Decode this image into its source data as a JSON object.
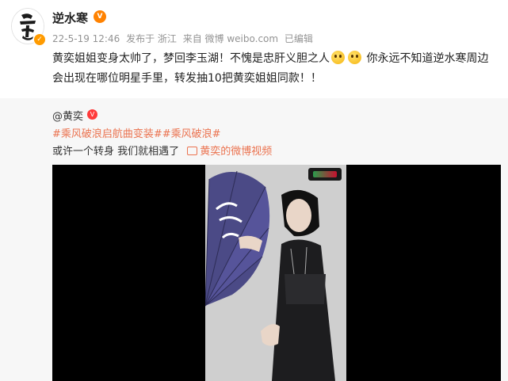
{
  "post": {
    "author": "逆水寒",
    "date": "22-5-19 12:46",
    "published_from": "发布于 浙江",
    "source": "来自 微博 weibo.com",
    "edited": "已编辑",
    "text_part1": "黄奕姐姐变身太帅了，梦回李玉湖！不愧是忠肝义胆之人",
    "text_part2": "你永远不知道逆水寒周边会出现在哪位明星手里，转发抽10把黄奕姐姐同款！！",
    "icons": [
      "avatar-logo",
      "verified-badge",
      "vip-icon",
      "emoji-face"
    ]
  },
  "repost": {
    "author": "@黄奕",
    "hashtags": "#乘风破浪启航曲变装##乘风破浪#",
    "text": "或许一个转身 我们就相遇了",
    "video_link": "黄奕的微博视频"
  },
  "colors": {
    "accent": "#eb7350",
    "repost_bg": "#f7f7f7",
    "meta_text": "#939393"
  }
}
